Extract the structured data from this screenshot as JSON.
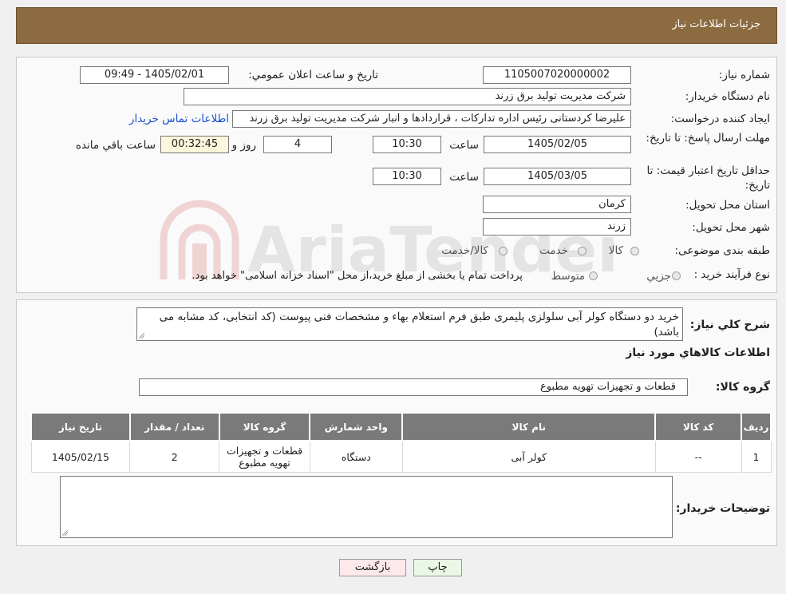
{
  "header": {
    "title": "جزئيات اطلاعات نياز"
  },
  "form": {
    "need_number_label": "شماره نياز:",
    "need_number_value": "1105007020000002",
    "announce_label": "تاريخ و ساعت اعلان عمومي:",
    "announce_value": "1405/02/01 - 09:49",
    "buyer_org_label": "نام دستگاه خريدار:",
    "buyer_org_value": "شرکت مديريت توليد برق زرند",
    "creator_label": "ايجاد کننده درخواست:",
    "creator_value": "عليرضا کردستانی رئيس اداره تدارکات ، قراردادها و انبار  شرکت مديريت توليد برق زرند",
    "contact_link": "اطلاعات تماس خريدار",
    "deadline_label": "مهلت ارسال پاسخ: تا تاريخ:",
    "deadline_date": "1405/02/05",
    "time_label": "ساعت",
    "deadline_time": "10:30",
    "days_value": "4",
    "days_label": "روز و",
    "remaining_value": "00:32:45",
    "remaining_label": "ساعت باقي مانده",
    "validity_label": "حداقل تاريخ اعتبار قيمت: تا تاريخ:",
    "validity_date": "1405/03/05",
    "validity_time": "10:30",
    "province_label": "استان محل تحويل:",
    "province_value": "کرمان",
    "city_label": "شهر محل تحويل:",
    "city_value": "زرند",
    "category_label": "طبقه بندی موضوعی:",
    "category_options": [
      "کالا",
      "خدمت",
      "کالا/خدمت"
    ],
    "process_label": "نوع فرآيند خريد :",
    "process_options": [
      "جزيي",
      "متوسط"
    ],
    "process_note": "پرداخت تمام يا بخشی از مبلغ خريد،از محل \"اسناد خزانه اسلامی\" خواهد بود."
  },
  "description": {
    "label": "شرح کلي نياز:",
    "text": "خريد دو دستگاه کولر آبی سلولزی پليمری طبق فرم استعلام بهاء و مشخصات فنی پيوست (کد انتخابی، کد مشابه می باشد)"
  },
  "goods": {
    "section_title": "اطلاعات کالاهاي مورد نياز",
    "group_label": "گروه کالا:",
    "group_value": "قطعات و تجهيزات تهويه مطبوع",
    "columns": [
      "رديف",
      "کد کالا",
      "نام کالا",
      "واحد شمارش",
      "گروه کالا",
      "تعداد / مقدار",
      "تاريخ نياز"
    ],
    "rows": [
      [
        "1",
        "--",
        "کولر آبی",
        "دستگاه",
        "قطعات و تجهيزات تهويه مطبوع",
        "2",
        "1405/02/15"
      ]
    ]
  },
  "buyer_notes": {
    "label": "توضيحات خريدار:",
    "value": ""
  },
  "buttons": {
    "print": "چاپ",
    "back": "بازگشت"
  },
  "colors": {
    "header_bg": "#8b6b3f",
    "table_header_bg": "#7a7a7a",
    "link": "#1a4fd1",
    "print_bg": "#eaf7e6",
    "back_bg": "#fde8ea",
    "remaining_bg": "#fbf6dc"
  },
  "watermark": {
    "text": "AriaTender.neT"
  }
}
